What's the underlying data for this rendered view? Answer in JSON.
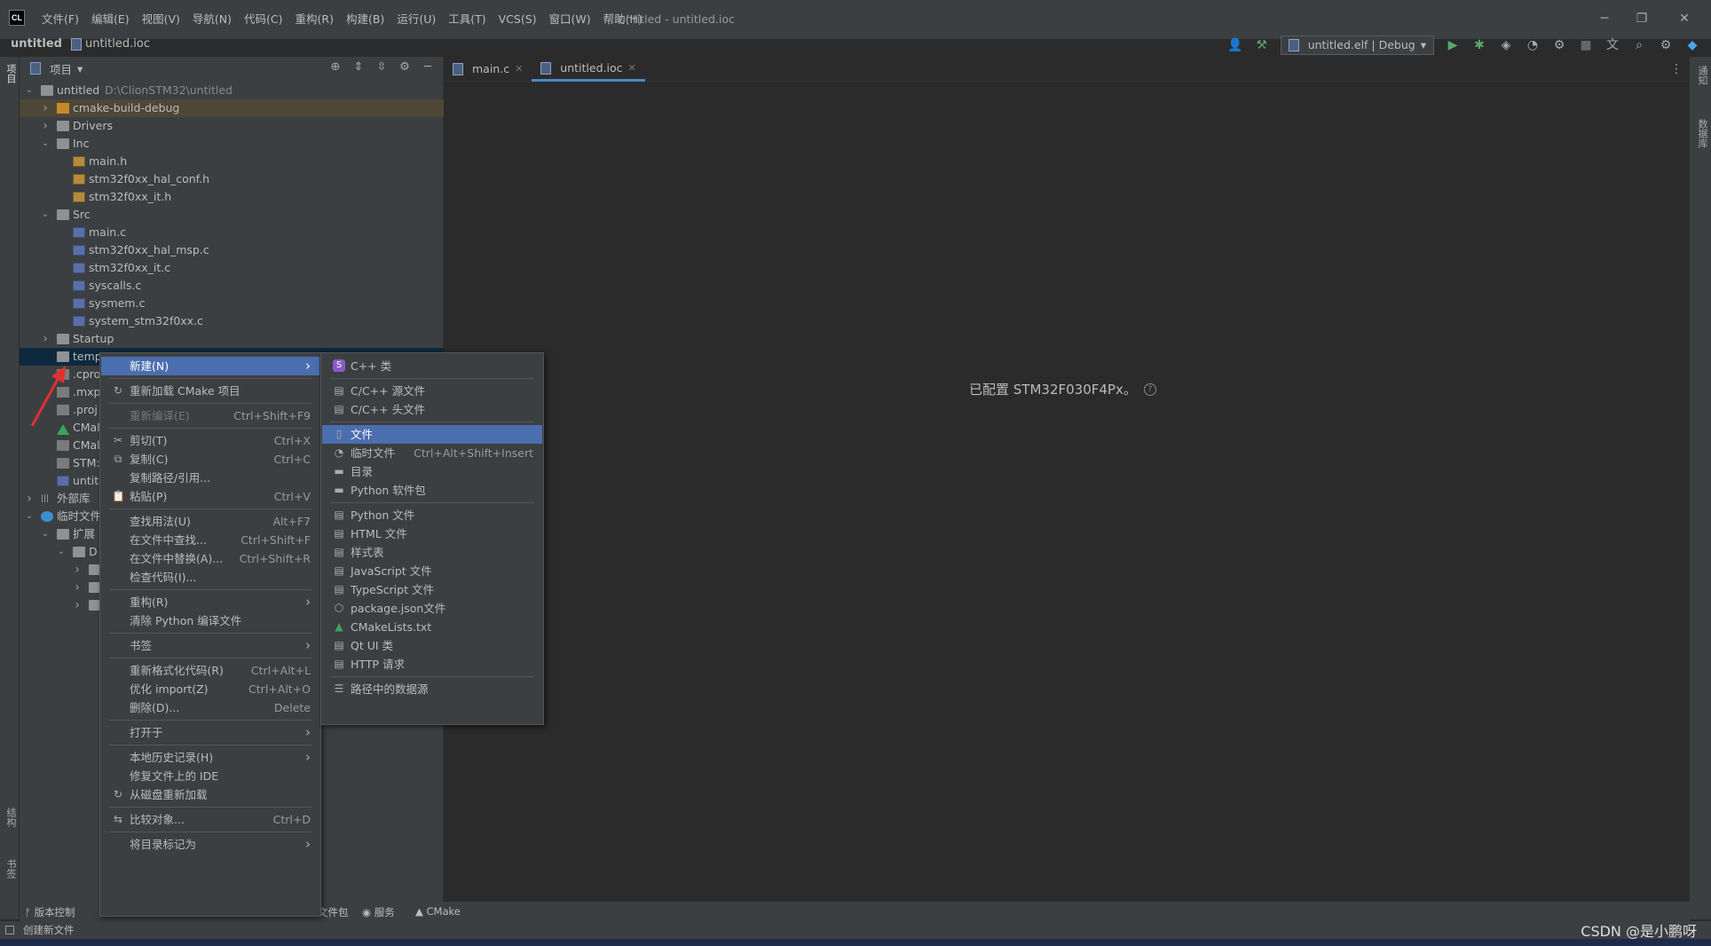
{
  "title_bar": {
    "app_icon": "CL",
    "menu": [
      "文件(F)",
      "编辑(E)",
      "视图(V)",
      "导航(N)",
      "代码(C)",
      "重构(R)",
      "构建(B)",
      "运行(U)",
      "工具(T)",
      "VCS(S)",
      "窗口(W)",
      "帮助(H)"
    ],
    "window_title": "untitled - untitled.ioc"
  },
  "breadcrumb": {
    "root": "untitled",
    "file": "untitled.ioc"
  },
  "toolbar": {
    "run_config": "untitled.elf | Debug"
  },
  "left_strip": {
    "top_label": "项目",
    "mid_label": "结构",
    "bottom_label": "书签"
  },
  "right_strip": {
    "top_label": "通知",
    "bottom_label": "数据库"
  },
  "project_panel": {
    "title": "项目"
  },
  "tree": [
    {
      "label": "untitled",
      "path": "D:\\ClionSTM32\\untitled",
      "depth": 0,
      "open": true,
      "type": "folder"
    },
    {
      "label": "cmake-build-debug",
      "depth": 1,
      "open": false,
      "type": "folder-orange"
    },
    {
      "label": "Drivers",
      "depth": 1,
      "open": false,
      "type": "folder"
    },
    {
      "label": "Inc",
      "depth": 1,
      "open": true,
      "type": "folder"
    },
    {
      "label": "main.h",
      "depth": 2,
      "type": "h"
    },
    {
      "label": "stm32f0xx_hal_conf.h",
      "depth": 2,
      "type": "h"
    },
    {
      "label": "stm32f0xx_it.h",
      "depth": 2,
      "type": "h"
    },
    {
      "label": "Src",
      "depth": 1,
      "open": true,
      "type": "folder"
    },
    {
      "label": "main.c",
      "depth": 2,
      "type": "c"
    },
    {
      "label": "stm32f0xx_hal_msp.c",
      "depth": 2,
      "type": "c"
    },
    {
      "label": "stm32f0xx_it.c",
      "depth": 2,
      "type": "c"
    },
    {
      "label": "syscalls.c",
      "depth": 2,
      "type": "c"
    },
    {
      "label": "sysmem.c",
      "depth": 2,
      "type": "c"
    },
    {
      "label": "system_stm32f0xx.c",
      "depth": 2,
      "type": "c"
    },
    {
      "label": "Startup",
      "depth": 1,
      "open": false,
      "type": "folder"
    },
    {
      "label": "temp",
      "depth": 1,
      "type": "folder"
    },
    {
      "label": ".cpro",
      "depth": 1,
      "type": "gen"
    },
    {
      "label": ".mxp",
      "depth": 1,
      "type": "gen"
    },
    {
      "label": ".proj",
      "depth": 1,
      "type": "gen"
    },
    {
      "label": "CMal",
      "depth": 1,
      "type": "cmake"
    },
    {
      "label": "CMal",
      "depth": 1,
      "type": "gen"
    },
    {
      "label": "STM:",
      "depth": 1,
      "type": "gen"
    },
    {
      "label": "untitl",
      "depth": 1,
      "type": "c"
    },
    {
      "label": "外部库",
      "depth": 0,
      "open": false,
      "type": "lib"
    },
    {
      "label": "临时文件",
      "depth": 0,
      "open": true,
      "type": "scratch"
    },
    {
      "label": "扩展",
      "depth": 1,
      "open": true,
      "type": "folder"
    },
    {
      "label": "D",
      "depth": 2,
      "open": true,
      "type": "folder"
    },
    {
      "label": "",
      "depth": 3,
      "open": false,
      "type": "folder"
    },
    {
      "label": "",
      "depth": 3,
      "open": false,
      "type": "folder"
    },
    {
      "label": "",
      "depth": 3,
      "open": false,
      "type": "folder"
    }
  ],
  "tabs": [
    {
      "label": "main.c",
      "active": false
    },
    {
      "label": "untitled.ioc",
      "active": true
    }
  ],
  "editor": {
    "message": "已配置 STM32F030F4Px。"
  },
  "context_menu": [
    {
      "label": "新建(N)",
      "shortcut": "",
      "submenu": true,
      "selected": true
    },
    {
      "sep": true
    },
    {
      "label": "重新加载 CMake 项目",
      "icon": "reload-icon"
    },
    {
      "sep": true
    },
    {
      "label": "重新编译(E)",
      "shortcut": "Ctrl+Shift+F9",
      "disabled": true
    },
    {
      "sep": true
    },
    {
      "label": "剪切(T)",
      "shortcut": "Ctrl+X",
      "icon": "scissors-icon"
    },
    {
      "label": "复制(C)",
      "shortcut": "Ctrl+C",
      "icon": "copy-icon"
    },
    {
      "label": "复制路径/引用...",
      "shortcut": ""
    },
    {
      "label": "粘贴(P)",
      "shortcut": "Ctrl+V",
      "icon": "paste-icon"
    },
    {
      "sep": true
    },
    {
      "label": "查找用法(U)",
      "shortcut": "Alt+F7"
    },
    {
      "label": "在文件中查找...",
      "shortcut": "Ctrl+Shift+F"
    },
    {
      "label": "在文件中替换(A)...",
      "shortcut": "Ctrl+Shift+R"
    },
    {
      "label": "检查代码(I)..."
    },
    {
      "sep": true
    },
    {
      "label": "重构(R)",
      "submenu": true
    },
    {
      "label": "清除 Python 编译文件"
    },
    {
      "sep": true
    },
    {
      "label": "书签",
      "submenu": true
    },
    {
      "sep": true
    },
    {
      "label": "重新格式化代码(R)",
      "shortcut": "Ctrl+Alt+L"
    },
    {
      "label": "优化 import(Z)",
      "shortcut": "Ctrl+Alt+O"
    },
    {
      "label": "删除(D)...",
      "shortcut": "Delete"
    },
    {
      "sep": true
    },
    {
      "label": "打开于",
      "submenu": true
    },
    {
      "sep": true
    },
    {
      "label": "本地历史记录(H)",
      "submenu": true
    },
    {
      "label": "修复文件上的 IDE"
    },
    {
      "label": "从磁盘重新加载",
      "icon": "reload-icon"
    },
    {
      "sep": true
    },
    {
      "label": "比较对象...",
      "shortcut": "Ctrl+D",
      "icon": "compare-icon"
    },
    {
      "sep": true
    },
    {
      "label": "将目录标记为",
      "submenu": true
    }
  ],
  "sub_menu": [
    {
      "label": "C++ 类",
      "icon": "cpp-class-icon"
    },
    {
      "sep": true
    },
    {
      "label": "C/C++ 源文件",
      "icon": "c-source-icon"
    },
    {
      "label": "C/C++ 头文件",
      "icon": "c-header-icon"
    },
    {
      "sep": true
    },
    {
      "label": "文件",
      "icon": "file-icon",
      "selected": true
    },
    {
      "label": "临时文件",
      "shortcut": "Ctrl+Alt+Shift+Insert",
      "icon": "scratch-icon"
    },
    {
      "label": "目录",
      "icon": "folder-icon"
    },
    {
      "label": "Python 软件包",
      "icon": "python-package-icon"
    },
    {
      "sep": true
    },
    {
      "label": "Python 文件",
      "icon": "python-file-icon"
    },
    {
      "label": "HTML 文件",
      "icon": "html-file-icon"
    },
    {
      "label": "样式表",
      "icon": "css-file-icon"
    },
    {
      "label": "JavaScript 文件",
      "icon": "js-file-icon"
    },
    {
      "label": "TypeScript 文件",
      "icon": "ts-file-icon"
    },
    {
      "label": "package.json文件",
      "icon": "package-json-icon"
    },
    {
      "label": "CMakeLists.txt",
      "icon": "cmake-icon"
    },
    {
      "label": "Qt UI 类",
      "icon": "qt-icon"
    },
    {
      "label": "HTTP 请求",
      "icon": "http-icon"
    },
    {
      "sep": true
    },
    {
      "label": "路径中的数据源",
      "icon": "datasource-icon"
    }
  ],
  "bottom_tools": [
    {
      "label": "版本控制",
      "icon": "vcs-icon"
    },
    {
      "label": "文件包",
      "icon": ""
    },
    {
      "label": "服务",
      "icon": "services-icon"
    },
    {
      "label": "CMake",
      "icon": "cmake-icon"
    }
  ],
  "status": {
    "left": "创建新文件"
  },
  "watermark": "CSDN @是小鹏呀",
  "colors": {
    "selection": "#4b6eaf",
    "panel": "#3c3f41",
    "editor": "#2b2b2b",
    "annotation_arrow": "#e03030"
  }
}
